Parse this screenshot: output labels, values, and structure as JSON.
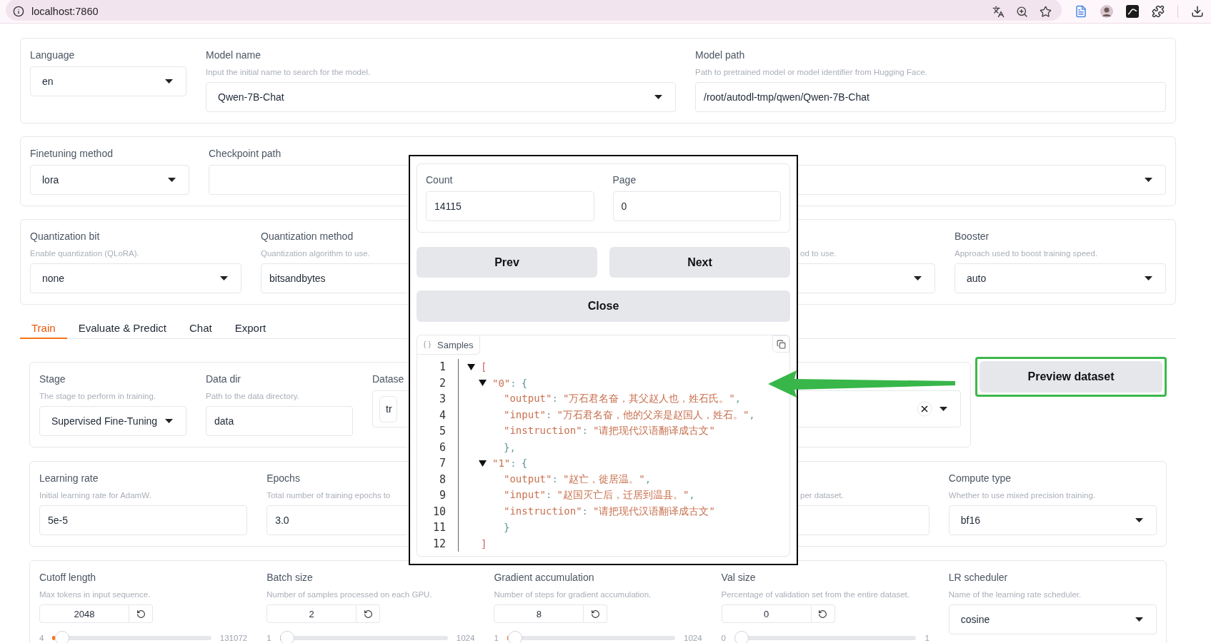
{
  "browser": {
    "url": "localhost:7860"
  },
  "top_panels": [
    {
      "fields": [
        {
          "label": "Language",
          "kind": "dropdown",
          "value": "en"
        },
        {
          "label": "Model name",
          "hint": "Input the initial name to search for the model.",
          "kind": "dropdown",
          "value": "Qwen-7B-Chat"
        },
        {
          "label": "Model path",
          "hint": "Path to pretrained model or model identifier from Hugging Face.",
          "kind": "textbox",
          "value": "/root/autodl-tmp/qwen/Qwen-7B-Chat"
        }
      ]
    },
    {
      "fields": [
        {
          "label": "Finetuning method",
          "kind": "dropdown",
          "value": "lora"
        },
        {
          "label": "Checkpoint path",
          "kind": "textbox"
        },
        {
          "kind": "dropdown"
        }
      ]
    },
    {
      "fields": [
        {
          "label": "Quantization bit",
          "hint": "Enable quantization (QLoRA).",
          "kind": "dropdown",
          "value": "none"
        },
        {
          "label": "Quantization method",
          "hint": "Quantization algorithm to use.",
          "kind": "textbox",
          "value": "bitsandbytes"
        },
        {
          "hint": "od to use.",
          "kind": "dropdown"
        },
        {
          "label": "Booster",
          "hint": "Approach used to boost training speed.",
          "kind": "dropdown",
          "value": "auto"
        }
      ]
    }
  ],
  "tabs": [
    {
      "label": "Train",
      "selected": true
    },
    {
      "label": "Evaluate & Predict",
      "selected": false
    },
    {
      "label": "Chat",
      "selected": false
    },
    {
      "label": "Export",
      "selected": false
    }
  ],
  "train": {
    "fields": [
      {
        "label": "Stage",
        "hint": "The stage to perform in training.",
        "kind": "dropdown",
        "value": "Supervised Fine-Tuning"
      },
      {
        "label": "Data dir",
        "hint": "Path to the data directory.",
        "kind": "textbox",
        "value": "data"
      },
      {
        "label": "Datase",
        "kind": "multiselect",
        "chips": [
          "tr"
        ]
      }
    ],
    "preview_button": "Preview dataset"
  },
  "lr_panel": {
    "fields": [
      {
        "label": "Learning rate",
        "hint": "Initial learning rate for AdamW.",
        "kind": "textbox",
        "value": "5e-5"
      },
      {
        "label": "Epochs",
        "hint": "Total number of training epochs to",
        "kind": "textbox",
        "value": "3.0"
      },
      {
        "hint": "per dataset.",
        "kind": "textbox"
      },
      {
        "label": "Compute type",
        "hint": "Whether to use mixed precision training.",
        "kind": "dropdown",
        "value": "bf16"
      }
    ]
  },
  "cutoff_panel": {
    "fields": [
      {
        "label": "Cutoff length",
        "hint": "Max tokens in input sequence.",
        "kind": "slider",
        "value": "2048",
        "min": "4",
        "max": "131072",
        "level": 0.016
      },
      {
        "label": "Batch size",
        "hint": "Number of samples processed on each GPU.",
        "kind": "slider",
        "value": "2",
        "min": "1",
        "max": "1024",
        "level": 0.001
      },
      {
        "label": "Gradient accumulation",
        "hint": "Number of steps for gradient accumulation.",
        "kind": "slider",
        "value": "8",
        "min": "1",
        "max": "1024",
        "level": 0.007
      },
      {
        "label": "Val size",
        "hint": "Percentage of validation set from the entire dataset.",
        "kind": "slider",
        "value": "0",
        "min": "0",
        "max": "1",
        "level": 0
      },
      {
        "label": "LR scheduler",
        "hint": "Name of the learning rate scheduler.",
        "kind": "dropdown",
        "value": "cosine"
      }
    ]
  },
  "modal": {
    "count": {
      "label": "Count",
      "value": "14115"
    },
    "page": {
      "label": "Page",
      "value": "0"
    },
    "buttons": [
      "Prev",
      "Next"
    ],
    "close": "Close",
    "samples": {
      "title": "Samples",
      "lines": [
        {
          "num": "1",
          "expanded": true,
          "tokens": [
            {
              "kind": "bracket",
              "text": "["
            }
          ],
          "children": [
            {
              "num": "2",
              "expanded": true,
              "tokens": [
                {
                  "kind": "key",
                  "text": "\"0\""
                },
                {
                  "kind": "colon",
                  "text": ":"
                },
                {
                  "kind": "brace",
                  "text": "{"
                }
              ],
              "children": [
                {
                  "num": "3",
                  "tokens": [
                    {
                      "kind": "key",
                      "text": "\"output\""
                    },
                    {
                      "kind": "colon",
                      "text": ":"
                    },
                    {
                      "kind": "string",
                      "text": "\"万石君名奋，其父赵人也，姓石氏。\""
                    },
                    {
                      "kind": "comma",
                      "text": ","
                    }
                  ]
                },
                {
                  "num": "4",
                  "tokens": [
                    {
                      "kind": "key",
                      "text": "\"input\""
                    },
                    {
                      "kind": "colon",
                      "text": ":"
                    },
                    {
                      "kind": "string",
                      "text": "\"万石君名奋，他的父亲是赵国人，姓石。\""
                    },
                    {
                      "kind": "comma",
                      "text": ","
                    }
                  ]
                },
                {
                  "num": "5",
                  "tokens": [
                    {
                      "kind": "key",
                      "text": "\"instruction\""
                    },
                    {
                      "kind": "colon",
                      "text": ":"
                    },
                    {
                      "kind": "string",
                      "text": "\"请把现代汉语翻译成古文\""
                    }
                  ]
                },
                {
                  "num": "6",
                  "tokens": [
                    {
                      "kind": "brace",
                      "text": "}"
                    },
                    {
                      "kind": "comma",
                      "text": ","
                    }
                  ]
                }
              ]
            },
            {
              "num": "7",
              "expanded": true,
              "tokens": [
                {
                  "kind": "key",
                  "text": "\"1\""
                },
                {
                  "kind": "colon",
                  "text": ":"
                },
                {
                  "kind": "brace",
                  "text": "{"
                }
              ],
              "children": [
                {
                  "num": "8",
                  "tokens": [
                    {
                      "kind": "key",
                      "text": "\"output\""
                    },
                    {
                      "kind": "colon",
                      "text": ":"
                    },
                    {
                      "kind": "string",
                      "text": "\"赵亡，徙居温。\""
                    },
                    {
                      "kind": "comma",
                      "text": ","
                    }
                  ]
                },
                {
                  "num": "9",
                  "tokens": [
                    {
                      "kind": "key",
                      "text": "\"input\""
                    },
                    {
                      "kind": "colon",
                      "text": ":"
                    },
                    {
                      "kind": "string",
                      "text": "\"赵国灭亡后，迁居到温县。\""
                    },
                    {
                      "kind": "comma",
                      "text": ","
                    }
                  ]
                },
                {
                  "num": "10",
                  "tokens": [
                    {
                      "kind": "key",
                      "text": "\"instruction\""
                    },
                    {
                      "kind": "colon",
                      "text": ":"
                    },
                    {
                      "kind": "string",
                      "text": "\"请把现代汉语翻译成古文\""
                    }
                  ]
                },
                {
                  "num": "11",
                  "tokens": [
                    {
                      "kind": "brace",
                      "text": "}"
                    }
                  ]
                }
              ]
            }
          ]
        },
        {
          "num": "12",
          "tokens": [
            {
              "kind": "bracket",
              "text": "]"
            }
          ]
        }
      ]
    }
  }
}
